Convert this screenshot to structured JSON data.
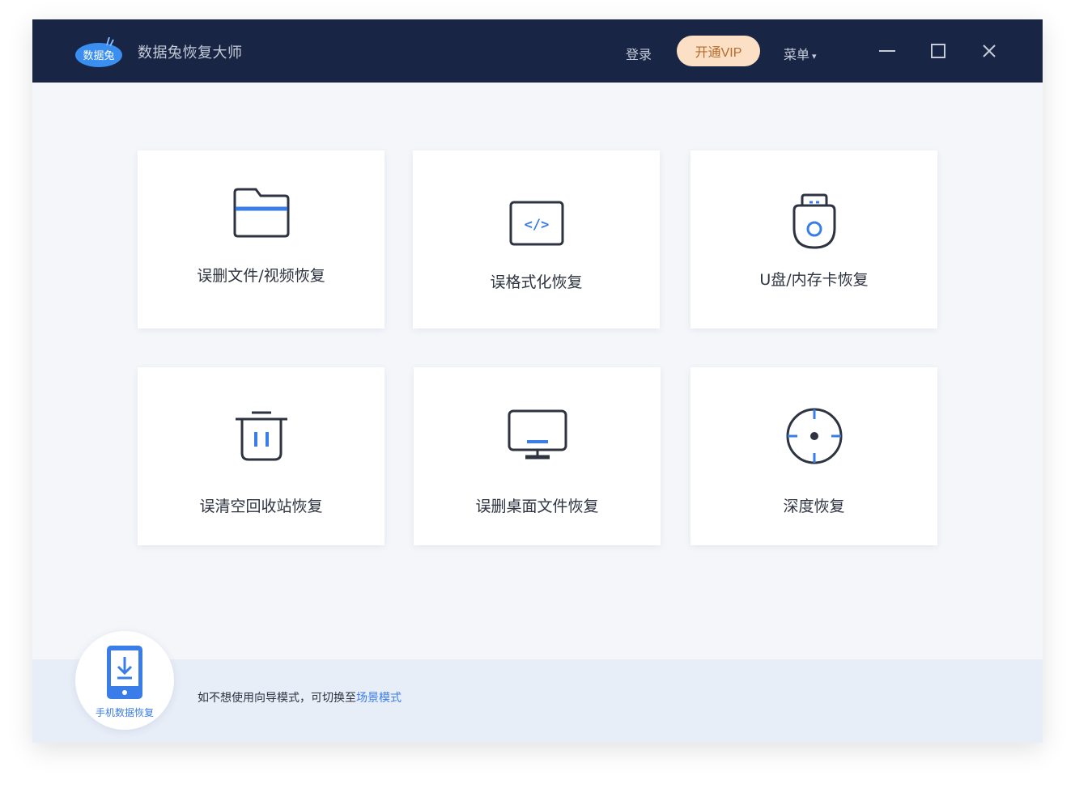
{
  "header": {
    "logo_text": "数据兔",
    "app_title": "数据兔恢复大师",
    "login_label": "登录",
    "vip_label": "开通VIP",
    "menu_label": "菜单",
    "caret": "▾"
  },
  "cards": [
    {
      "label": "误删文件/视频恢复",
      "icon": "folder-icon"
    },
    {
      "label": "误格式化恢复",
      "icon": "code-window-icon"
    },
    {
      "label": "U盘/内存卡恢复",
      "icon": "usb-drive-icon"
    },
    {
      "label": "误清空回收站恢复",
      "icon": "trash-icon"
    },
    {
      "label": "误删桌面文件恢复",
      "icon": "monitor-icon"
    },
    {
      "label": "深度恢复",
      "icon": "target-icon"
    }
  ],
  "bottom": {
    "mobile_label": "手机数据恢复",
    "hint_prefix": "如不想使用向导模式，可切换至",
    "hint_link": "场景模式"
  },
  "colors": {
    "titlebar": "#182544",
    "accent": "#3a7de8",
    "vip_bg": "#fbe0c6",
    "vip_text": "#b66a2a",
    "content_bg": "#f4f6fa"
  }
}
